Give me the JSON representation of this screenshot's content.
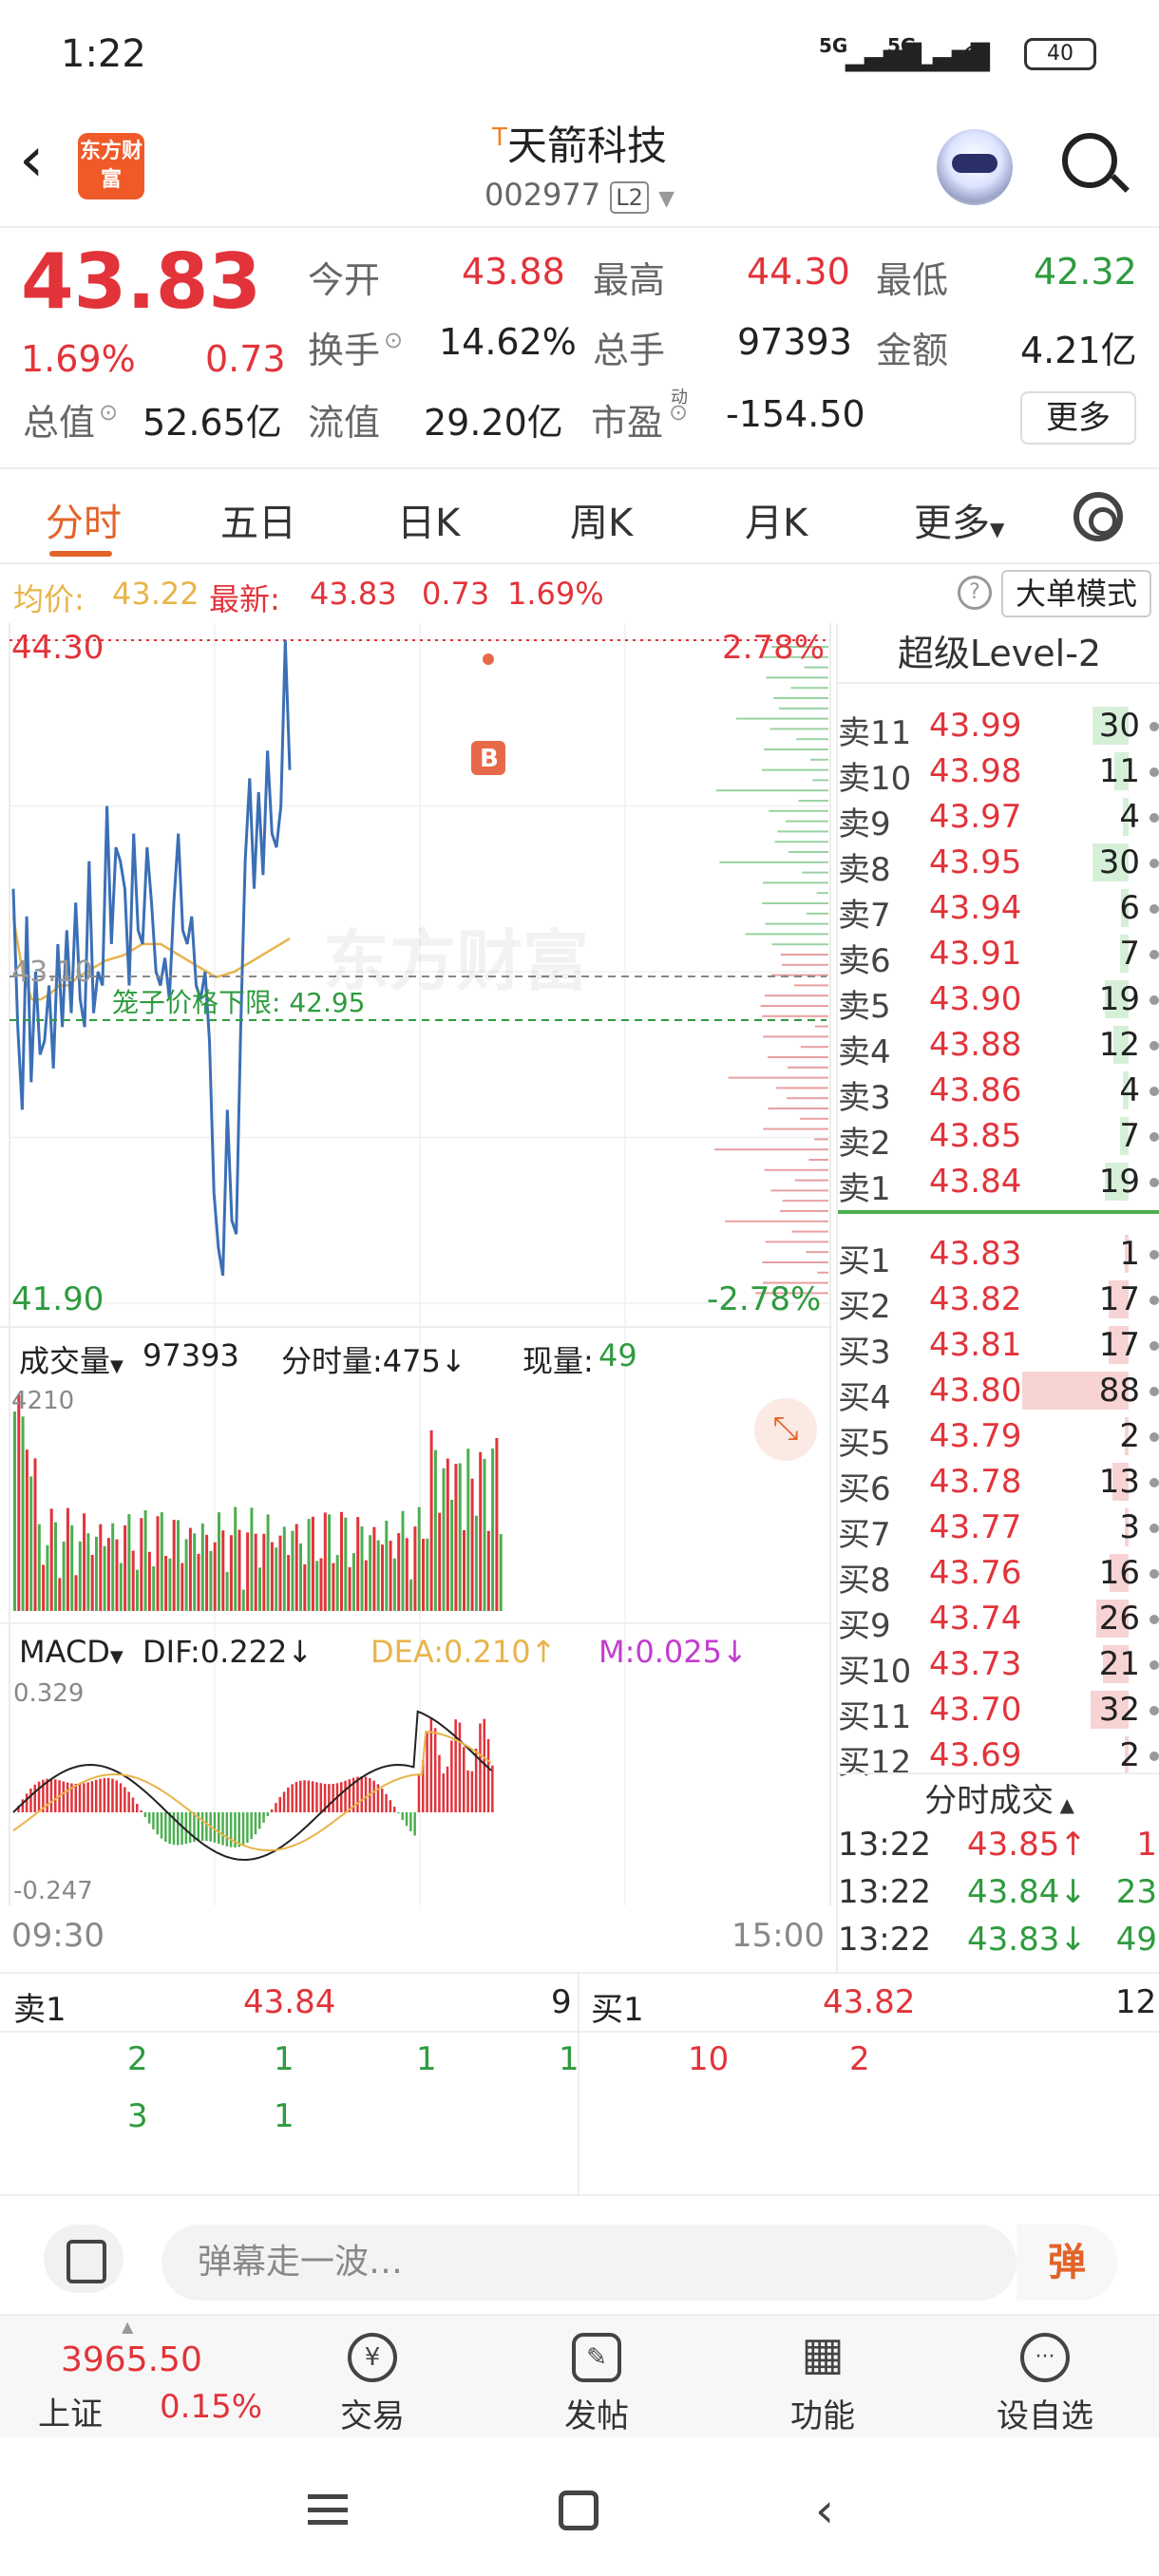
{
  "status_bar": {
    "time": "1:22",
    "signal1": "5G",
    "signal2": "5G",
    "battery": "40"
  },
  "header": {
    "logo_text": "东方财富",
    "t_mark": "T",
    "stock_name": "天箭科技",
    "stock_code": "002977",
    "level_badge": "L2"
  },
  "quote": {
    "price": "43.83",
    "change_pct": "1.69%",
    "change": "0.73",
    "rows": [
      [
        {
          "label": "今开",
          "value": "43.88",
          "color": "#e2333a"
        },
        {
          "label": "最高",
          "value": "44.30",
          "color": "#e2333a"
        },
        {
          "label": "最低",
          "value": "42.32",
          "color": "#2e9b3e"
        }
      ],
      [
        {
          "label": "换手",
          "value": "14.62%",
          "color": "#222222"
        },
        {
          "label": "总手",
          "value": "97393",
          "color": "#222222"
        },
        {
          "label": "金额",
          "value": "4.21亿",
          "color": "#222222"
        }
      ]
    ],
    "total_value_label": "总值",
    "total_value": "52.65亿",
    "float_value_label": "流值",
    "float_value": "29.20亿",
    "pe_label": "市盈",
    "pe_sup": "动",
    "pe_value": "-154.50",
    "more_label": "更多"
  },
  "tabs": {
    "items": [
      "分时",
      "五日",
      "日K",
      "周K",
      "月K",
      "更多"
    ],
    "active": "分时"
  },
  "info_line": {
    "avg_label": "均价:",
    "avg_value": "43.22",
    "latest_label": "最新:",
    "latest_value": "43.83",
    "change": "0.73",
    "change_pct": "1.69%",
    "mode_label": "大单模式"
  },
  "chart_labels": {
    "high": "44.30",
    "low": "41.90",
    "high_pct": "2.78%",
    "low_pct": "-2.78%",
    "base_price": "43.10",
    "cage_label": "笼子价格下限: 42.95",
    "volume_tab": "成交量",
    "volume_total": "97393",
    "minute_vol_label": "分时量:475↓",
    "current_vol_label": "现量:",
    "current_vol": "49",
    "vol_max": "4210",
    "macd_tab": "MACD",
    "dif": "DIF:0.222↓",
    "dea": "DEA:0.210↑",
    "m": "M:0.025↓",
    "macd_max": "0.329",
    "macd_min": "-0.247",
    "time_start": "09:30",
    "time_end": "15:00",
    "watermark": "东方财富",
    "buy_marker": "B"
  },
  "chart_data": {
    "type": "line",
    "title": "",
    "ylim": [
      41.9,
      44.3
    ],
    "x_range": [
      "09:30",
      "15:00"
    ],
    "series": [
      {
        "values": [
          43.4,
          42.9,
          42.6,
          43.3,
          42.7,
          43.1,
          42.8,
          42.85,
          43.05,
          42.75,
          43.2,
          42.9,
          43.25,
          42.95,
          43.35,
          43.0,
          42.9,
          43.5,
          42.95,
          43.1,
          43.05,
          43.7,
          43.2,
          43.55,
          43.5,
          43.4,
          43.05,
          43.6,
          43.25,
          43.2,
          43.55,
          43.35,
          43.1,
          43.05,
          43.15,
          43.0,
          43.35,
          43.6,
          43.25,
          43.2,
          43.3,
          43.05,
          43.0,
          43.1,
          42.85,
          42.3,
          42.1,
          42.0,
          42.6,
          42.2,
          42.15,
          42.9,
          43.5,
          43.8,
          43.4,
          43.75,
          43.45,
          43.9,
          43.6,
          43.55,
          43.7,
          44.3,
          43.83
        ]
      },
      {
        "values": [
          43.3,
          43.1,
          43.0,
          43.0,
          43.02,
          43.05,
          43.05,
          43.08,
          43.1,
          43.12,
          43.14,
          43.15,
          43.16,
          43.18,
          43.2,
          43.2,
          43.2,
          43.18,
          43.16,
          43.14,
          43.12,
          43.1,
          43.08,
          43.09,
          43.1,
          43.12,
          43.14,
          43.16,
          43.18,
          43.2,
          43.22
        ]
      }
    ],
    "volume_ylim": [
      0,
      4210
    ],
    "macd_ylim": [
      -0.247,
      0.329
    ]
  },
  "level2": {
    "title": "超级Level-2",
    "asks": [
      {
        "label": "卖11",
        "price": "43.99",
        "vol": "30",
        "bar": 0.34,
        "bar_color": "#d6f0d8"
      },
      {
        "label": "卖10",
        "price": "43.98",
        "vol": "11",
        "bar": 0.13,
        "bar_color": "#d6f0d8"
      },
      {
        "label": "卖9",
        "price": "43.97",
        "vol": "4",
        "bar": 0.05,
        "bar_color": "#d6f0d8"
      },
      {
        "label": "卖8",
        "price": "43.95",
        "vol": "30",
        "bar": 0.34,
        "bar_color": "#d6f0d8"
      },
      {
        "label": "卖7",
        "price": "43.94",
        "vol": "6",
        "bar": 0.07,
        "bar_color": "#d6f0d8"
      },
      {
        "label": "卖6",
        "price": "43.91",
        "vol": "7",
        "bar": 0.08,
        "bar_color": "#d6f0d8"
      },
      {
        "label": "卖5",
        "price": "43.90",
        "vol": "19",
        "bar": 0.22,
        "bar_color": "#d6f0d8"
      },
      {
        "label": "卖4",
        "price": "43.88",
        "vol": "12",
        "bar": 0.14,
        "bar_color": "#d6f0d8"
      },
      {
        "label": "卖3",
        "price": "43.86",
        "vol": "4",
        "bar": 0.05,
        "bar_color": "#d6f0d8"
      },
      {
        "label": "卖2",
        "price": "43.85",
        "vol": "7",
        "bar": 0.08,
        "bar_color": "#d6f0d8"
      },
      {
        "label": "卖1",
        "price": "43.84",
        "vol": "19",
        "bar": 0.22,
        "bar_color": "#d6f0d8"
      }
    ],
    "bids": [
      {
        "label": "买1",
        "price": "43.83",
        "vol": "1",
        "bar": 0.01,
        "bar_color": "#f7d3d3"
      },
      {
        "label": "买2",
        "price": "43.82",
        "vol": "17",
        "bar": 0.19,
        "bar_color": "#f7d3d3"
      },
      {
        "label": "买3",
        "price": "43.81",
        "vol": "17",
        "bar": 0.19,
        "bar_color": "#f7d3d3"
      },
      {
        "label": "买4",
        "price": "43.80",
        "vol": "88",
        "bar": 1.0,
        "bar_color": "#f7d3d3"
      },
      {
        "label": "买5",
        "price": "43.79",
        "vol": "2",
        "bar": 0.02,
        "bar_color": "#f7d3d3"
      },
      {
        "label": "买6",
        "price": "43.78",
        "vol": "13",
        "bar": 0.15,
        "bar_color": "#f7d3d3"
      },
      {
        "label": "买7",
        "price": "43.77",
        "vol": "3",
        "bar": 0.03,
        "bar_color": "#f7d3d3"
      },
      {
        "label": "买8",
        "price": "43.76",
        "vol": "16",
        "bar": 0.18,
        "bar_color": "#f7d3d3"
      },
      {
        "label": "买9",
        "price": "43.74",
        "vol": "26",
        "bar": 0.3,
        "bar_color": "#f7d3d3"
      },
      {
        "label": "买10",
        "price": "43.73",
        "vol": "21",
        "bar": 0.24,
        "bar_color": "#f7d3d3"
      },
      {
        "label": "买11",
        "price": "43.70",
        "vol": "32",
        "bar": 0.36,
        "bar_color": "#f7d3d3"
      },
      {
        "label": "买12",
        "price": "43.69",
        "vol": "2",
        "bar": 0.02,
        "bar_color": "#f7d3d3"
      }
    ],
    "ticks_title": "分时成交",
    "ticks": [
      {
        "time": "13:22",
        "price": "43.85",
        "arrow": "↑",
        "vol": "1",
        "color": "#e2333a"
      },
      {
        "time": "13:22",
        "price": "43.84",
        "arrow": "↓",
        "vol": "23",
        "color": "#2e9b3e"
      },
      {
        "time": "13:22",
        "price": "43.83",
        "arrow": "↓",
        "vol": "49",
        "color": "#2e9b3e"
      }
    ]
  },
  "bottom_quote": {
    "ask_label": "卖1",
    "ask_price": "43.84",
    "ask_vol": "9",
    "bid_label": "买1",
    "bid_price": "43.82",
    "bid_vol": "12",
    "ask_queue_row1": [
      "2",
      "1",
      "1",
      "1"
    ],
    "ask_queue_row2": [
      "3",
      "1"
    ],
    "bid_queue_row1": [
      "10",
      "2"
    ]
  },
  "danmu": {
    "placeholder": "弹幕走一波…",
    "button": "弹"
  },
  "bottom_nav": {
    "index_value": "3965.50",
    "index_name": "上证",
    "index_pct": "0.15%",
    "items": [
      {
        "label": "交易",
        "icon": "yen-icon",
        "glyph": "¥"
      },
      {
        "label": "发帖",
        "icon": "edit-icon",
        "glyph": "✎"
      },
      {
        "label": "功能",
        "icon": "grid-icon",
        "glyph": "▦"
      },
      {
        "label": "设自选",
        "icon": "more-icon",
        "glyph": "···"
      }
    ]
  },
  "colors": {
    "up": "#e2333a",
    "down": "#2e9b3e",
    "price_line": "#3b6fb6",
    "avg_line": "#e8b44a",
    "accent": "#e2632a"
  }
}
